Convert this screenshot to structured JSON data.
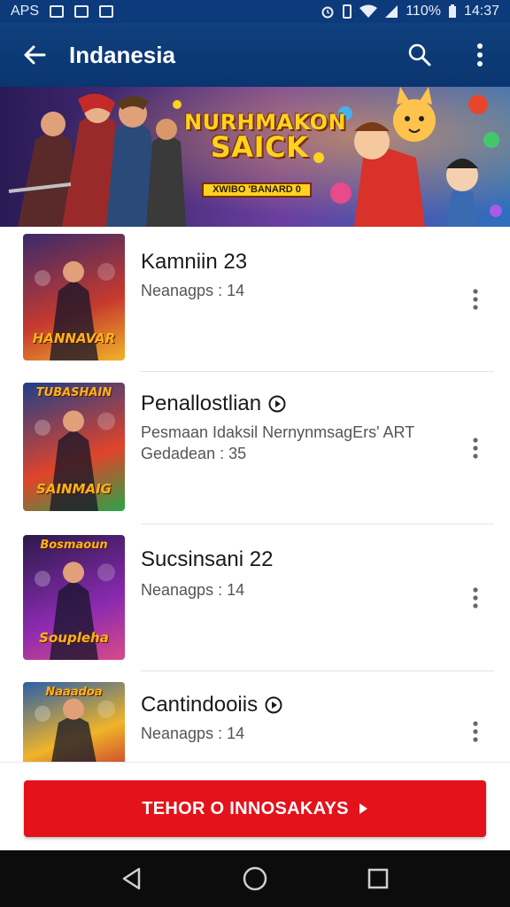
{
  "status_bar": {
    "carrier": "APS",
    "battery": "110%",
    "time": "14:37"
  },
  "app_bar": {
    "title": "Indanesia"
  },
  "banner": {
    "title_line1": "NURHMAKON",
    "title_line2": "SAICK",
    "subtitle": "XWIBO 'BANARD 0"
  },
  "games": [
    {
      "title": "Kamniin 23",
      "subtitle": "Neanagps : 14",
      "subtitle2": "",
      "has_badge": false,
      "thumb_label": "HANNAVAR",
      "thumb_top": "",
      "colors": [
        "#3a2a6a",
        "#c73a2e",
        "#f0b429"
      ]
    },
    {
      "title": "Penallostlian",
      "subtitle": "Pesmaan Idaksil NernynmsagErs' ART",
      "subtitle2": "Gedadean : 35",
      "has_badge": true,
      "thumb_label": "SAINMAIG",
      "thumb_top": "TUBASHAIN",
      "colors": [
        "#1f3f8a",
        "#e0442a",
        "#2aa34a"
      ]
    },
    {
      "title": "Sucsinsani 22",
      "subtitle": "Neanagps : 14",
      "subtitle2": "",
      "has_badge": false,
      "thumb_label": "Soupleha",
      "thumb_top": "Bosmaoun",
      "colors": [
        "#2a1a4a",
        "#8a2ab0",
        "#d84a8a"
      ]
    },
    {
      "title": "Cantindooiis",
      "subtitle": "Neanagps : 14",
      "subtitle2": "",
      "has_badge": true,
      "thumb_label": "",
      "thumb_top": "Naaadoa",
      "colors": [
        "#2a5fa8",
        "#f0b429",
        "#c73a2e"
      ]
    }
  ],
  "cta": {
    "label": "TEHOR O INNOSAKAYS"
  },
  "icons": {
    "back": "arrow-left-icon",
    "search": "search-icon",
    "more": "more-vert-icon",
    "play_badge": "play-circle-icon",
    "cta_arrow": "triangle-right-icon",
    "nav_back": "triangle-back-icon",
    "nav_home": "circle-home-icon",
    "nav_recent": "square-recent-icon"
  },
  "colors": {
    "app_bar": "#0a3570",
    "cta": "#e3121b",
    "nav_bar": "#0c0c0c"
  }
}
